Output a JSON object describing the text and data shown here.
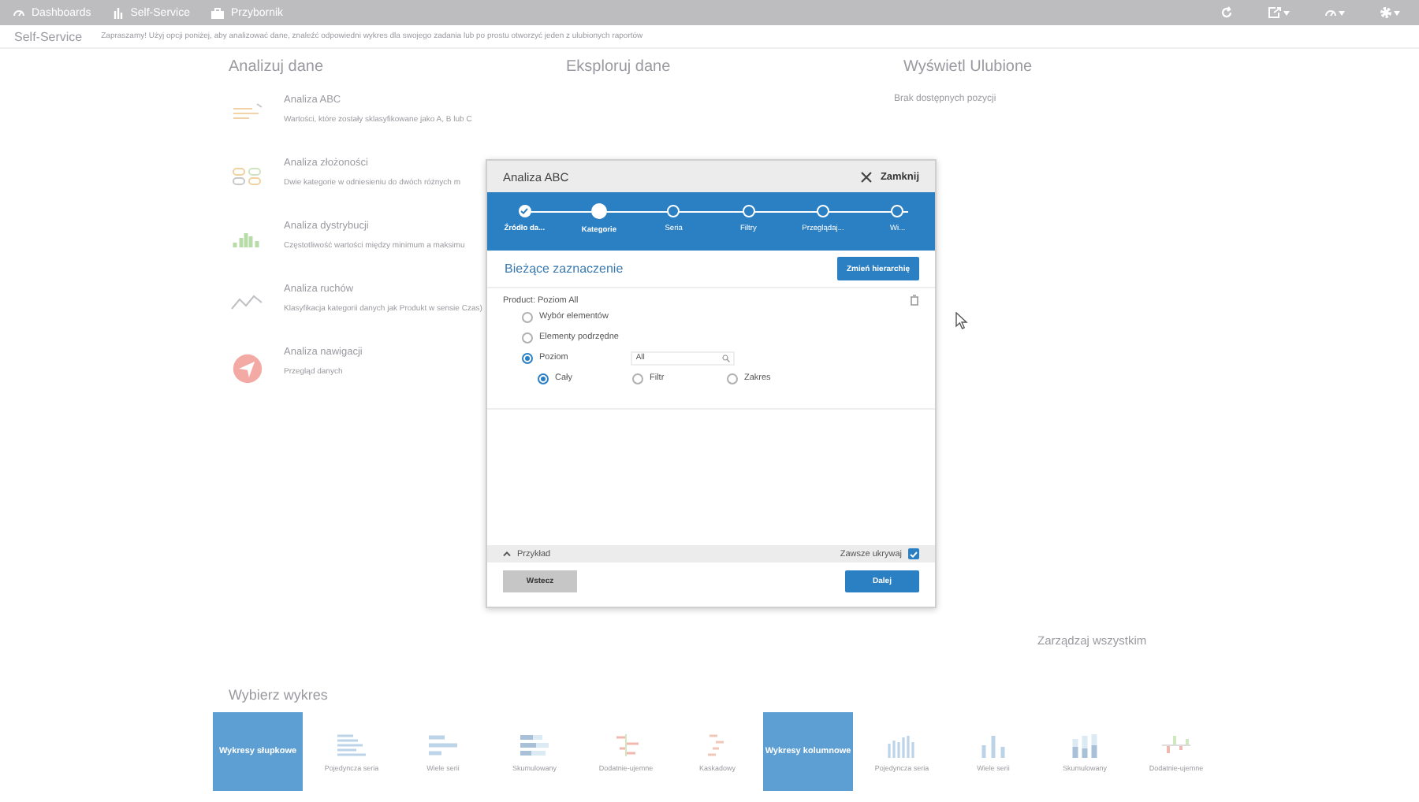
{
  "topbar": {
    "nav": [
      {
        "label": "Dashboards",
        "kind": "gauge"
      },
      {
        "label": "Self-Service",
        "kind": "bars"
      },
      {
        "label": "Przybornik",
        "kind": "toolbox"
      }
    ],
    "tools": [
      {
        "kind": "refresh",
        "dropdown": false
      },
      {
        "kind": "share",
        "dropdown": true
      },
      {
        "kind": "gauge",
        "dropdown": true
      },
      {
        "kind": "gear",
        "dropdown": true
      }
    ]
  },
  "subheader": {
    "title": "Self-Service",
    "intro": "Zapraszamy! Użyj opcji poniżej, aby analizować dane, znaleźć odpowiedni wykres dla swojego zadania lub po prostu otworzyć jeden z ulubionych raportów"
  },
  "analyze": {
    "heading": "Analizuj dane",
    "items": [
      {
        "kind": "abc",
        "title": "Analiza ABC",
        "description": "Wartości, które zostały sklasyfikowane jako A, B lub C"
      },
      {
        "kind": "complexity",
        "title": "Analiza złożoności",
        "description": "Dwie kategorie w odniesieniu do dwóch różnych m"
      },
      {
        "kind": "distribution",
        "title": "Analiza dystrybucji",
        "description": "Częstotliwość wartości między minimum a maksimu"
      },
      {
        "kind": "movement",
        "title": "Analiza ruchów",
        "description": "Klasyfikacja kategorii danych jak Produkt w sensie Czas)"
      },
      {
        "kind": "navigation",
        "title": "Analiza nawigacji",
        "description": "Przegląd danych"
      }
    ]
  },
  "explore": {
    "heading": "Eksploruj dane"
  },
  "favorites": {
    "heading": "Wyświetl Ulubione",
    "empty": "Brak dostępnych pozycji"
  },
  "manage_link": "Zarządzaj wszystkim",
  "charts": {
    "heading": "Wybierz wykres",
    "items": [
      {
        "kind": "group",
        "label": "Wykresy słupkowe"
      },
      {
        "kind": "bar-single",
        "label": "Pojedyncza seria"
      },
      {
        "kind": "bar-multi",
        "label": "Wiele serii"
      },
      {
        "kind": "bar-stacked",
        "label": "Skumulowany"
      },
      {
        "kind": "bar-posneg",
        "label": "Dodatnie-ujemne"
      },
      {
        "kind": "waterfall",
        "label": "Kaskadowy"
      },
      {
        "kind": "group",
        "label": "Wykresy kolumnowe"
      },
      {
        "kind": "col-single",
        "label": "Pojedyncza seria"
      },
      {
        "kind": "col-multi",
        "label": "Wiele serii"
      },
      {
        "kind": "col-stacked",
        "label": "Skumulowany"
      },
      {
        "kind": "col-posneg",
        "label": "Dodatnie-ujemne"
      }
    ]
  },
  "dialog": {
    "title": "Analiza ABC",
    "close": "Zamknij",
    "steps": [
      {
        "label": "Źródło da...",
        "completed": true,
        "selected": false
      },
      {
        "label": "Kategorie",
        "completed": false,
        "selected": true
      },
      {
        "label": "Seria",
        "completed": false,
        "selected": false
      },
      {
        "label": "Filtry",
        "completed": false,
        "selected": false
      },
      {
        "label": "Przeglądaj...",
        "completed": false,
        "selected": false
      },
      {
        "label": "Wi...",
        "completed": false,
        "selected": false
      }
    ],
    "section_title": "Bieżące zaznaczenie",
    "change_button": "Zmień hierarchię",
    "selection_label": "Product: Poziom All",
    "options": [
      {
        "label": "Wybór elementów",
        "selected": false
      },
      {
        "label": "Elementy podrzędne",
        "selected": false
      },
      {
        "label": "Poziom",
        "selected": true,
        "value": "All"
      }
    ],
    "sub_options": [
      {
        "label": "Cały",
        "selected": true
      },
      {
        "label": "Filtr",
        "selected": false
      },
      {
        "label": "Zakres",
        "selected": false
      }
    ],
    "example": {
      "label": "Przykład",
      "expanded": true
    },
    "always_hide": {
      "label": "Zawsze ukrywaj",
      "checked": true
    },
    "back_button": "Wstecz",
    "next_button": "Dalej"
  }
}
